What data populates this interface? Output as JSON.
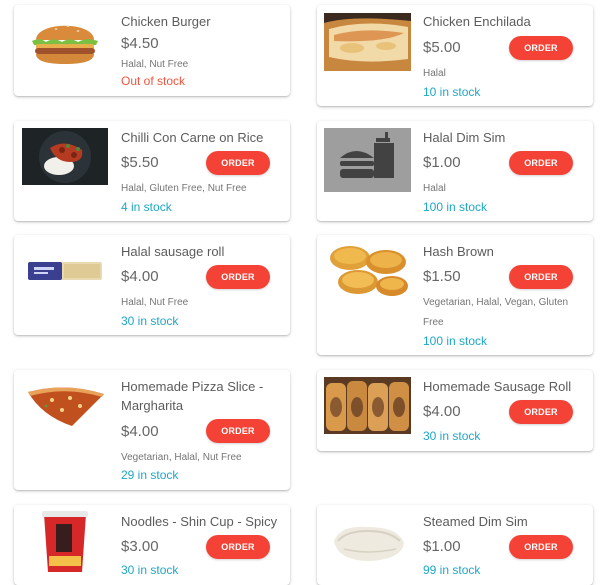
{
  "order_label": "ORDER",
  "colors": {
    "accent": "#f44336",
    "in_stock": "#1ea7c5",
    "out_of_stock": "#f0533e"
  },
  "items": [
    {
      "name": "Chicken Burger",
      "price": "$4.50",
      "tags": "Halal, Nut Free",
      "stock": "Out of stock",
      "available": false,
      "image": "burger"
    },
    {
      "name": "Chicken Enchilada",
      "price": "$5.00",
      "tags": "Halal",
      "stock": "10 in stock",
      "available": true,
      "image": "enchilada"
    },
    {
      "name": "Chilli Con Carne on Rice",
      "price": "$5.50",
      "tags": "Halal, Gluten Free, Nut Free",
      "stock": "4 in stock",
      "available": true,
      "image": "chilli-bowl"
    },
    {
      "name": "Halal Dim Sim",
      "price": "$1.00",
      "tags": "Halal",
      "stock": "100 in stock",
      "available": true,
      "image": "fast-food-icon"
    },
    {
      "name": "Halal sausage roll",
      "price": "$4.00",
      "tags": "Halal, Nut Free",
      "stock": "30 in stock",
      "available": true,
      "image": "packaged-roll"
    },
    {
      "name": "Hash Brown",
      "price": "$1.50",
      "tags": "Vegetarian, Halal, Vegan, Gluten Free",
      "stock": "100 in stock",
      "available": true,
      "image": "hash-browns"
    },
    {
      "name": "Homemade Pizza Slice - Margharita",
      "price": "$4.00",
      "tags": "Vegetarian, Halal, Nut Free",
      "stock": "29 in stock",
      "available": true,
      "image": "pizza-slice"
    },
    {
      "name": "Homemade Sausage Roll",
      "price": "$4.00",
      "tags": "",
      "stock": "30 in stock",
      "available": true,
      "image": "sausage-rolls"
    },
    {
      "name": "Noodles - Shin Cup - Spicy",
      "price": "$3.00",
      "tags": "",
      "stock": "30 in stock",
      "available": true,
      "image": "noodle-cup"
    },
    {
      "name": "Steamed Dim Sim",
      "price": "$1.00",
      "tags": "",
      "stock": "99 in stock",
      "available": true,
      "image": "dim-sim"
    }
  ]
}
